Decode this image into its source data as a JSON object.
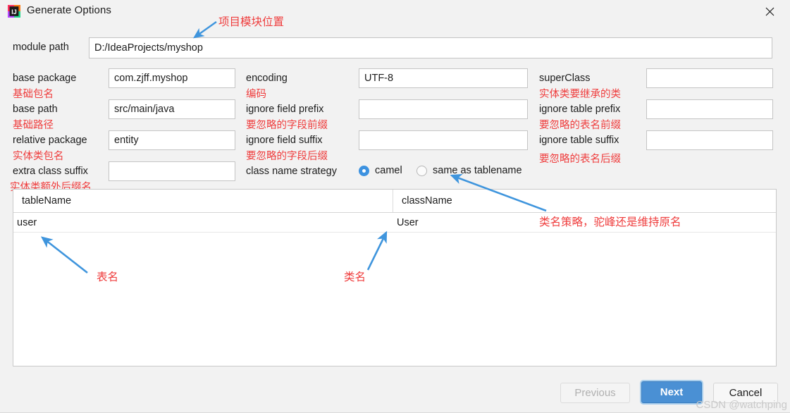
{
  "window": {
    "title": "Generate Options",
    "app_icon": "intellij-idea-icon",
    "close_icon": "close-icon"
  },
  "form": {
    "module_path": {
      "label": "module path",
      "value": "D:/IdeaProjects/myshop",
      "annotation": "项目模块位置"
    },
    "base_package": {
      "label": "base package",
      "value": "com.zjff.myshop",
      "annotation": "基础包名"
    },
    "base_path": {
      "label": "base path",
      "value": "src/main/java",
      "annotation": "基础路径"
    },
    "relative_package": {
      "label": "relative package",
      "value": "entity",
      "annotation": "实体类包名"
    },
    "extra_class_suffix": {
      "label": "extra class suffix",
      "value": "",
      "annotation": "实体类额外后缀名"
    },
    "encoding": {
      "label": "encoding",
      "value": "UTF-8",
      "annotation": "编码"
    },
    "ignore_field_prefix": {
      "label": "ignore field prefix",
      "value": "",
      "annotation": "要忽略的字段前缀"
    },
    "ignore_field_suffix": {
      "label": "ignore field suffix",
      "value": "",
      "annotation": "要忽略的字段后缀"
    },
    "super_class": {
      "label": "superClass",
      "value": "",
      "annotation": "实体类要继承的类"
    },
    "ignore_table_prefix": {
      "label": "ignore table prefix",
      "value": "",
      "annotation": "要忽略的表名前缀"
    },
    "ignore_table_suffix": {
      "label": "ignore table suffix",
      "value": "",
      "annotation": "要忽略的表名后缀"
    },
    "class_name_strategy": {
      "label": "class name strategy",
      "annotation": "类名策略，驼峰还是维持原名",
      "selected": "camel",
      "options": [
        {
          "value": "camel",
          "label": "camel",
          "checked": true
        },
        {
          "value": "same_as_tablename",
          "label": "same as tablename",
          "checked": false
        }
      ]
    }
  },
  "table": {
    "columns": [
      "tableName",
      "className"
    ],
    "rows": [
      {
        "tableName": "user",
        "className": "User"
      }
    ],
    "annotations": {
      "table_name": "表名",
      "class_name": "类名"
    }
  },
  "footer": {
    "previous": "Previous",
    "next": "Next",
    "cancel": "Cancel"
  },
  "watermark": "CSDN @watchping",
  "colors": {
    "accent": "#4a90d4",
    "annotation_red": "#ef3d3d",
    "arrow_blue": "#3f95dd",
    "dialog_bg": "#f2f2f2"
  }
}
